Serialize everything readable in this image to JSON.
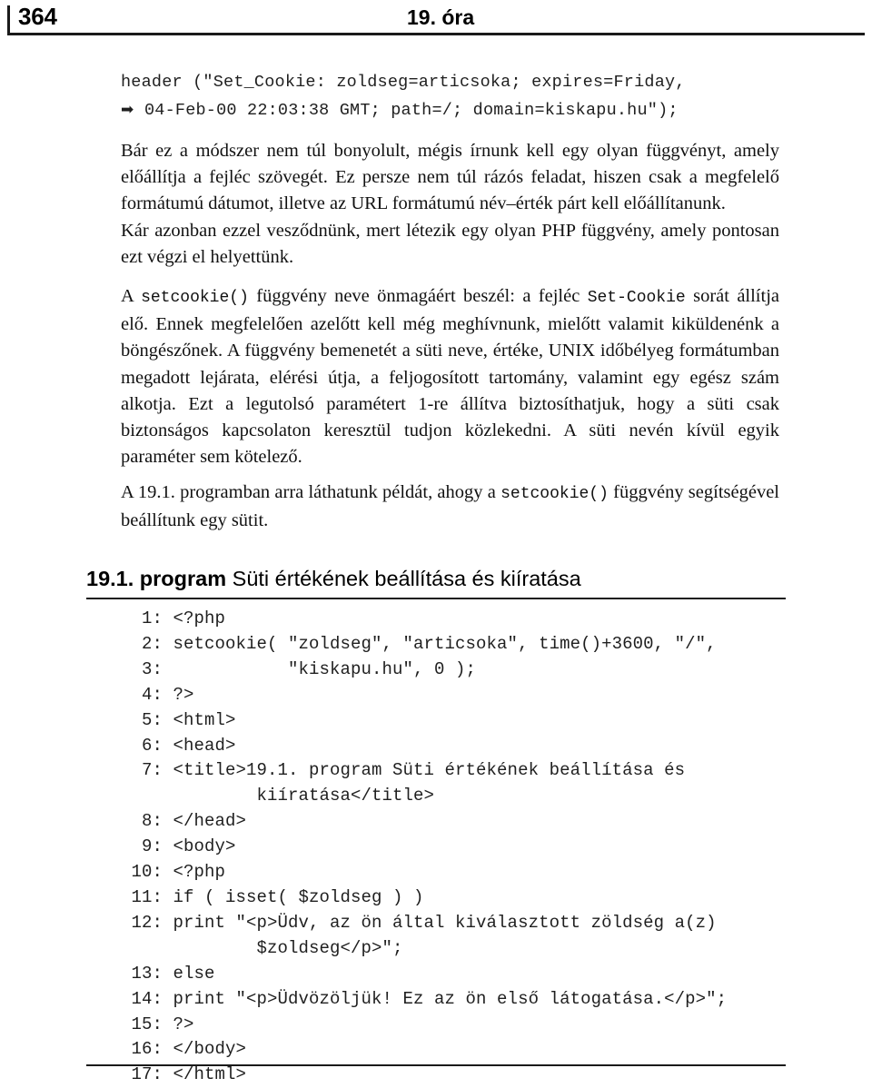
{
  "page": {
    "folio": "364",
    "running_head": "19. óra"
  },
  "snippet": {
    "lines": [
      "header (\"Set_Cookie: zoldseg=articsoka; expires=Friday,",
      "04-Feb-00 22:03:38 GMT; path=/; domain=kiskapu.hu\");"
    ],
    "continuation_marker": "➡"
  },
  "paragraphs": [
    {
      "id": "p1",
      "runs": [
        {
          "type": "text",
          "value": "Bár ez a módszer nem túl bonyolult, mégis írnunk kell egy olyan függvényt, amely előállítja a fejléc szövegét. Ez persze nem túl rázós feladat, hiszen csak a megfelelő formátumú dátumot, illetve az URL formátumú név–érték párt kell előállítanunk."
        }
      ]
    },
    {
      "id": "p2",
      "runs": [
        {
          "type": "text",
          "value": "Kár azonban ezzel vesződnünk, mert létezik egy olyan PHP függvény, amely pontosan ezt végzi el helyettünk."
        }
      ]
    },
    {
      "id": "p3",
      "runs": [
        {
          "type": "text",
          "value": "A "
        },
        {
          "type": "code",
          "value": "setcookie()"
        },
        {
          "type": "text",
          "value": " függvény neve önmagáért beszél: a fejléc "
        },
        {
          "type": "code",
          "value": "Set-Cookie"
        },
        {
          "type": "text",
          "value": " sorát állítja elő. Ennek megfelelően azelőtt kell még meghívnunk, mielőtt valamit kiküldenénk a böngészőnek. A függvény bemenetét a süti neve, értéke, UNIX időbélyeg formátumban megadott lejárata, elérési útja, a feljogosított tartomány, valamint egy egész szám alkotja. Ezt a legutolsó paramétert 1-re állítva biztosíthatjuk, hogy a süti csak biztonságos kapcsolaton keresztül tudjon közlekedni. A süti nevén kívül egyik paraméter sem kötelező."
        }
      ]
    },
    {
      "id": "p4",
      "runs": [
        {
          "type": "text",
          "value": "A 19.1. programban arra láthatunk példát, ahogy a "
        },
        {
          "type": "code",
          "value": "setcookie()"
        },
        {
          "type": "text",
          "value": " függvény segítségével beállítunk egy sütit."
        }
      ]
    }
  ],
  "listing_heading": {
    "number": "19.1. program",
    "caption": "Süti értékének beállítása és kiíratása"
  },
  "listing": {
    "lines": [
      {
        "no": "1",
        "code": "<?php"
      },
      {
        "no": "2",
        "code": "setcookie( \"zoldseg\", \"articsoka\", time()+3600, \"/\","
      },
      {
        "no": "3",
        "code": "           \"kiskapu.hu\", 0 );"
      },
      {
        "no": "4",
        "code": "?>"
      },
      {
        "no": "5",
        "code": "<html>"
      },
      {
        "no": "6",
        "code": "<head>"
      },
      {
        "no": "7",
        "code": "<title>19.1. program Süti értékének beállítása és"
      },
      {
        "no": "",
        "code": "        kiíratása</title>",
        "continuation": true
      },
      {
        "no": "8",
        "code": "</head>"
      },
      {
        "no": "9",
        "code": "<body>"
      },
      {
        "no": "10",
        "code": "<?php"
      },
      {
        "no": "11",
        "code": "if ( isset( $zoldseg ) )"
      },
      {
        "no": "12",
        "code": "print \"<p>Üdv, az ön által kiválasztott zöldség a(z)"
      },
      {
        "no": "",
        "code": "        $zoldseg</p>\";",
        "continuation": true
      },
      {
        "no": "13",
        "code": "else"
      },
      {
        "no": "14",
        "code": "print \"<p>Üdvözöljük! Ez az ön első látogatása.</p>\";"
      },
      {
        "no": "15",
        "code": "?>"
      },
      {
        "no": "16",
        "code": "</body>"
      },
      {
        "no": "17",
        "code": "</html>"
      }
    ]
  },
  "colors": {
    "rule": "#1a1a1a",
    "text": "#111111",
    "code": "#1f1f1f"
  }
}
